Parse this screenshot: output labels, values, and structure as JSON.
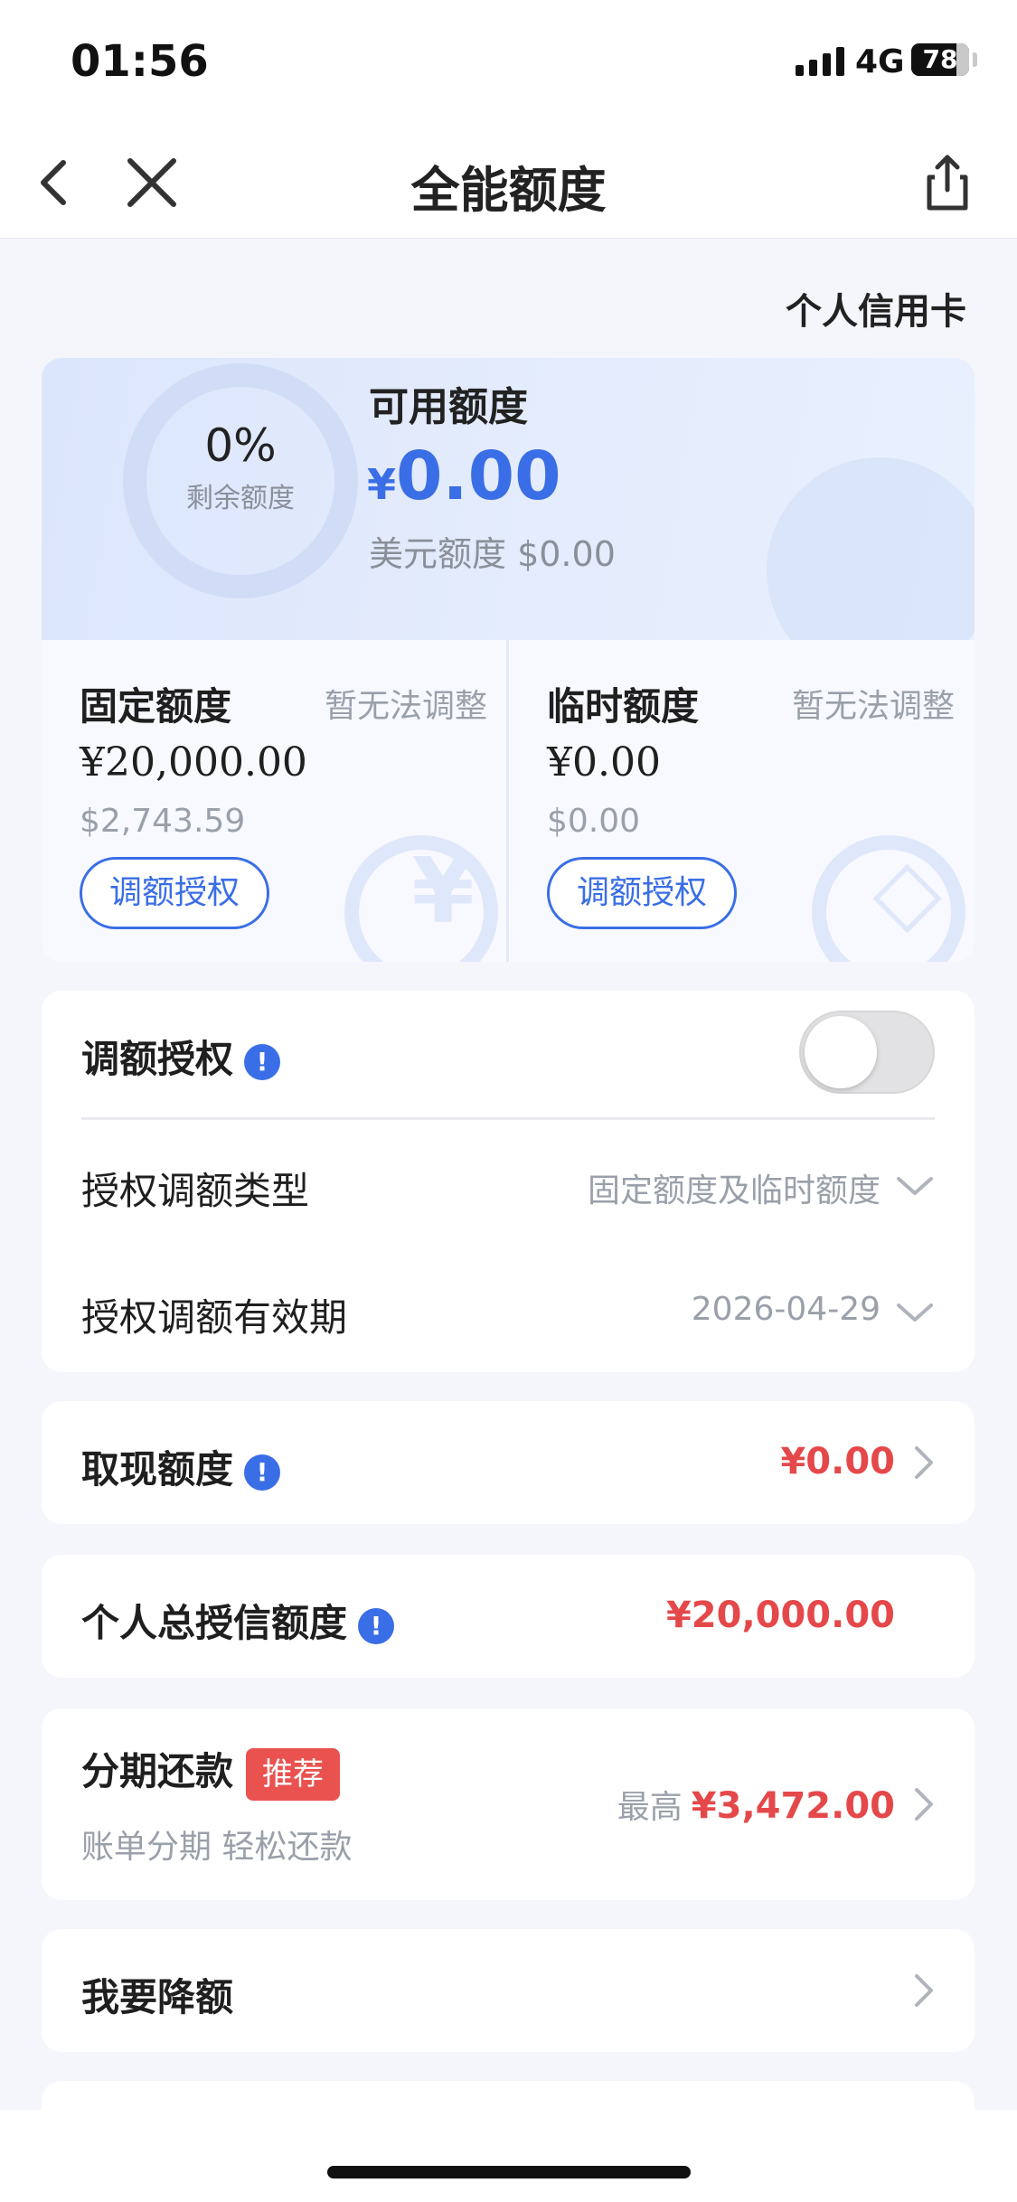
{
  "status_bar": {
    "time": "01:56",
    "network": "4G",
    "battery": "78",
    "battery_level": 0.78
  },
  "nav": {
    "title": "全能额度",
    "icons": [
      "back-icon",
      "close-icon",
      "share-icon"
    ]
  },
  "card_type": "个人信用卡",
  "limit_card": {
    "remaining_percent": "0%",
    "remaining_label": "剩余额度",
    "available_label": "可用额度",
    "available_currency": "¥",
    "available_amount": "0.00",
    "usd_limit_text": "美元额度 $0.00",
    "fixed": {
      "title": "固定额度",
      "note": "暂无法调整",
      "amount": "¥20,000.00",
      "usd": "$2,743.59",
      "button": "调额授权"
    },
    "temporary": {
      "title": "临时额度",
      "note": "暂无法调整",
      "amount": "¥0.00",
      "usd": "$0.00",
      "button": "调额授权"
    }
  },
  "authorization": {
    "label": "调额授权",
    "toggle_on": false,
    "type_label": "授权调额类型",
    "type_value": "固定额度及临时额度",
    "validity_label": "授权调额有效期",
    "validity_value": "2026-04-29"
  },
  "cash_advance": {
    "label": "取现额度",
    "value": "¥0.00"
  },
  "total_credit": {
    "label": "个人总授信额度",
    "value": "¥20,000.00"
  },
  "installment": {
    "label": "分期还款",
    "badge": "推荐",
    "sub": "账单分期 轻松还款",
    "prefix": "最高",
    "value": "¥3,472.00"
  },
  "reduce": {
    "label": "我要降额"
  },
  "colors": {
    "accent": "#3a6ee6",
    "danger": "#e5484a",
    "badge": "#e9524f",
    "background": "#f4f6fb"
  }
}
